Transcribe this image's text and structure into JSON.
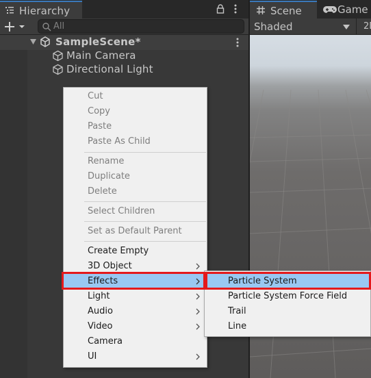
{
  "colors": {
    "editor_bg": "#383838",
    "accent_tab": "#3a79bb",
    "menu_bg": "#f0f0f0",
    "menu_selected": "#99c8f2",
    "highlight_box": "#e4191b"
  },
  "hierarchy": {
    "tab_label": "Hierarchy",
    "tab_icon": "list-icon",
    "search_placeholder": "All",
    "scene_name": "SampleScene*",
    "objects": [
      {
        "label": "Main Camera",
        "icon": "cube-icon"
      },
      {
        "label": "Directional Light",
        "icon": "cube-icon"
      }
    ]
  },
  "scene_panel": {
    "tabs": [
      {
        "label": "Scene",
        "icon": "hash-icon"
      },
      {
        "label": "Game",
        "icon": "gamepad-icon"
      }
    ],
    "shading_mode": "Shaded",
    "mode_2d": "2D"
  },
  "context_menu": {
    "items": [
      {
        "label": "Cut",
        "disabled": true
      },
      {
        "label": "Copy",
        "disabled": true
      },
      {
        "label": "Paste",
        "disabled": true
      },
      {
        "label": "Paste As Child",
        "disabled": true
      },
      {
        "label": "Rename",
        "disabled": true
      },
      {
        "label": "Duplicate",
        "disabled": true
      },
      {
        "label": "Delete",
        "disabled": true
      },
      {
        "label": "Select Children",
        "disabled": true
      },
      {
        "label": "Set as Default Parent",
        "disabled": true
      },
      {
        "label": "Create Empty",
        "disabled": false
      },
      {
        "label": "3D Object",
        "disabled": false,
        "submenu": true
      },
      {
        "label": "Effects",
        "disabled": false,
        "submenu": true,
        "selected": true,
        "highlighted": true
      },
      {
        "label": "Light",
        "disabled": false,
        "submenu": true
      },
      {
        "label": "Audio",
        "disabled": false,
        "submenu": true
      },
      {
        "label": "Video",
        "disabled": false,
        "submenu": true
      },
      {
        "label": "Camera",
        "disabled": false
      },
      {
        "label": "UI",
        "disabled": false,
        "submenu": true
      }
    ]
  },
  "effects_submenu": {
    "items": [
      {
        "label": "Particle System",
        "selected": true,
        "highlighted": true
      },
      {
        "label": "Particle System Force Field"
      },
      {
        "label": "Trail"
      },
      {
        "label": "Line"
      }
    ]
  }
}
